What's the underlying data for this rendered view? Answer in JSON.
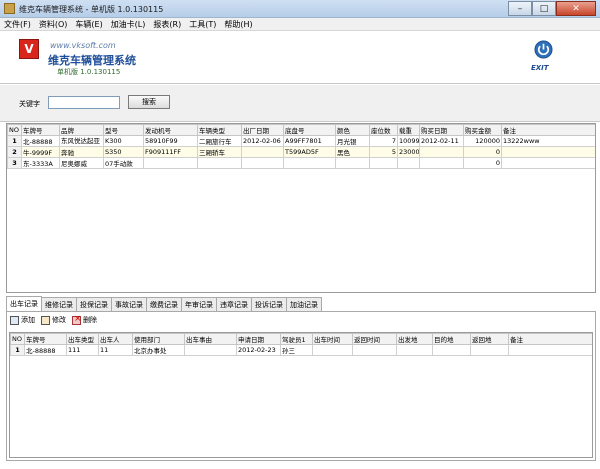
{
  "window": {
    "title": "维克车辆管理系统 - 单机版 1.0.130115",
    "controls": {
      "minimize": "–",
      "maximize": "□",
      "close": "✕"
    }
  },
  "menu": [
    "文件(F)",
    "资料(O)",
    "车辆(E)",
    "加油卡(L)",
    "报表(R)",
    "工具(T)",
    "帮助(H)"
  ],
  "banner": {
    "logo": "V",
    "site": "www.vksoft.com",
    "app_title": "维克车辆管理系统",
    "edition": "单机版 1.0.130115",
    "exit_label": "EXIT",
    "exit_icon": "power-icon"
  },
  "search": {
    "label": "关键字",
    "value": "",
    "button": "搜索"
  },
  "vehicles": {
    "columns": [
      "NO",
      "车牌号",
      "品牌",
      "型号",
      "发动机号",
      "车辆类型",
      "出厂日期",
      "底盘号",
      "颜色",
      "座位数",
      "载重",
      "购买日期",
      "购买金额",
      "备注"
    ],
    "rows": [
      [
        "1",
        "北-88888",
        "东风悦达起亚",
        "K300",
        "58910F99",
        "二厢旅行车",
        "2012-02-06",
        "A99FF7801",
        "月光银",
        "7",
        "10099",
        "2012-02-11",
        "120000",
        "13222www"
      ],
      [
        "2",
        "牛-9999F",
        "奔驰",
        "S350",
        "F909111FF",
        "三厢轿车",
        "",
        "T599AD5F",
        "黑色",
        "5",
        "23000",
        "",
        "0",
        ""
      ],
      [
        "3",
        "东-3333A",
        "尼奥娜威",
        "07手动款",
        "",
        "",
        "",
        "",
        "",
        "",
        "",
        "",
        "0",
        ""
      ]
    ]
  },
  "tabs": {
    "items": [
      "出车记录",
      "维修记录",
      "投保记录",
      "事故记录",
      "缴费记录",
      "年审记录",
      "违章记录",
      "投诉记录",
      "加油记录"
    ],
    "active": 0
  },
  "toolbar": {
    "add": "添加",
    "edit": "修改",
    "delete": "删除"
  },
  "trips": {
    "columns": [
      "NO",
      "车牌号",
      "出车类型",
      "出车人",
      "使用部门",
      "出车事由",
      "申请日期",
      "驾驶员1",
      "出车时间",
      "返回时间",
      "出发地",
      "目的地",
      "返回地",
      "备注"
    ],
    "rows": [
      [
        "1",
        "北-88888",
        "111",
        "11",
        "北京办事处",
        "",
        "2012-02-23",
        "孙三",
        "",
        "",
        "",
        "",
        "",
        ""
      ]
    ]
  }
}
